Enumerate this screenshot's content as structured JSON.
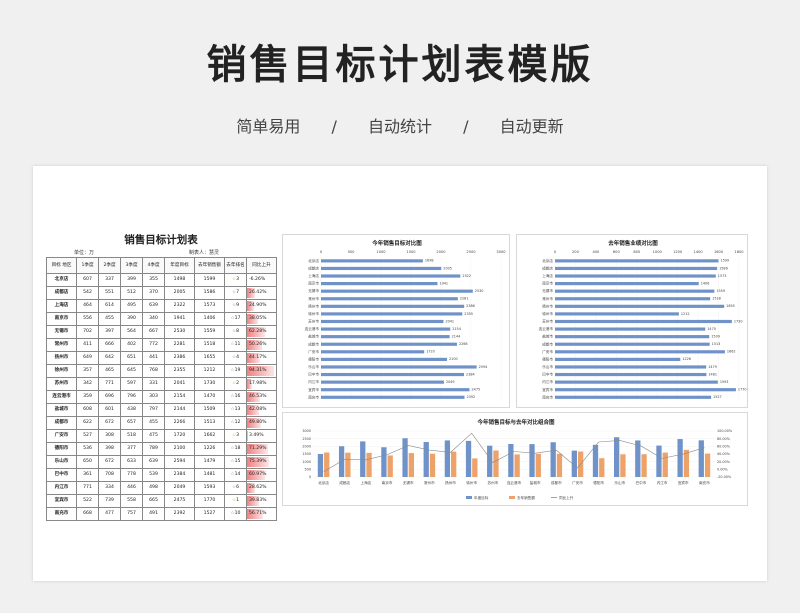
{
  "header": {
    "title": "销售目标计划表模版",
    "features": [
      "简单易用",
      "自动统计",
      "自动更新"
    ],
    "separator": "/"
  },
  "table": {
    "title": "销售目标计划表",
    "unit": "单位：万",
    "maker": "制表人：慧灵",
    "columns": [
      "目标 地区",
      "1季度",
      "2季度",
      "3季度",
      "4季度",
      "年度目标",
      "去年销售额",
      "去年排名",
      "同比上升"
    ],
    "rows": [
      [
        "北京店",
        "607",
        "337",
        "399",
        "355",
        "1498",
        "1599",
        "3",
        "-6.26%"
      ],
      [
        "成都店",
        "542",
        "551",
        "512",
        "370",
        "2005",
        "1586",
        "7",
        "26.42%"
      ],
      [
        "上海店",
        "464",
        "614",
        "495",
        "639",
        "2322",
        "1573",
        "9",
        "24.90%"
      ],
      [
        "南京市",
        "556",
        "455",
        "390",
        "340",
        "1941",
        "1406",
        "17",
        "38.05%"
      ],
      [
        "无锡市",
        "702",
        "397",
        "564",
        "667",
        "2530",
        "1559",
        "8",
        "62.28%"
      ],
      [
        "常州市",
        "411",
        "666",
        "402",
        "772",
        "2281",
        "1518",
        "11",
        "50.26%"
      ],
      [
        "扬州市",
        "649",
        "642",
        "651",
        "441",
        "2386",
        "1655",
        "4",
        "44.17%"
      ],
      [
        "徐州市",
        "357",
        "465",
        "645",
        "768",
        "2355",
        "1212",
        "19",
        "94.31%"
      ],
      [
        "苏州市",
        "342",
        "771",
        "597",
        "331",
        "2041",
        "1730",
        "2",
        "17.98%"
      ],
      [
        "连云港市",
        "359",
        "696",
        "796",
        "303",
        "2154",
        "1470",
        "16",
        "46.53%"
      ],
      [
        "盐城市",
        "608",
        "601",
        "438",
        "797",
        "2144",
        "1509",
        "13",
        "42.08%"
      ],
      [
        "成都市",
        "622",
        "672",
        "657",
        "455",
        "2266",
        "1513",
        "12",
        "49.80%"
      ],
      [
        "广安市",
        "527",
        "308",
        "518",
        "475",
        "1720",
        "1662",
        "3",
        "3.49%"
      ],
      [
        "德阳市",
        "536",
        "398",
        "377",
        "789",
        "2100",
        "1226",
        "18",
        "71.29%"
      ],
      [
        "乐山市",
        "650",
        "672",
        "633",
        "639",
        "2594",
        "1479",
        "15",
        "75.39%"
      ],
      [
        "巴中市",
        "361",
        "708",
        "778",
        "539",
        "2384",
        "1481",
        "14",
        "60.97%"
      ],
      [
        "内江市",
        "771",
        "334",
        "446",
        "498",
        "2049",
        "1593",
        "6",
        "28.62%"
      ],
      [
        "宜宾市",
        "522",
        "739",
        "558",
        "665",
        "2475",
        "1770",
        "1",
        "39.83%"
      ],
      [
        "南充市",
        "668",
        "477",
        "757",
        "491",
        "2392",
        "1527",
        "10",
        "56.71%"
      ]
    ]
  },
  "chart1": {
    "title": "今年销售目标对比图",
    "axis_ticks": [
      "0",
      "500",
      "1000",
      "1500",
      "2000",
      "2500",
      "3000"
    ]
  },
  "chart2": {
    "title": "去年销售业绩对比图",
    "axis_ticks": [
      "0",
      "200",
      "400",
      "600",
      "800",
      "1000",
      "1200",
      "1400",
      "1600",
      "1800"
    ]
  },
  "chart3": {
    "title": "今年销售目标与去年对比组合图",
    "y_left_ticks": [
      "0",
      "500",
      "1000",
      "1500",
      "2000",
      "2500",
      "3000"
    ],
    "y_right_ticks": [
      "-20.00%",
      "0.00%",
      "20.00%",
      "40.00%",
      "60.00%",
      "80.00%",
      "100.00%"
    ],
    "legend": [
      "年度目标",
      "去年销售额",
      "同比上升"
    ]
  },
  "colors": {
    "blue": "#6f93c8",
    "orange": "#eda26a",
    "gray": "#8a8a8a",
    "red": "#f08080"
  },
  "chart_data": [
    {
      "type": "bar",
      "title": "今年销售目标对比图",
      "categories": [
        "北京店",
        "成都店",
        "上海店",
        "南京市",
        "无锡市",
        "常州市",
        "扬州市",
        "徐州市",
        "苏州市",
        "连云港市",
        "盐城市",
        "成都市",
        "广安市",
        "德阳市",
        "乐山市",
        "巴中市",
        "内江市",
        "宜宾市",
        "南充市"
      ],
      "values": [
        1698,
        2005,
        2322,
        1941,
        2530,
        2281,
        2386,
        2355,
        2041,
        2154,
        2144,
        2266,
        1720,
        2100,
        2594,
        2384,
        2049,
        2475,
        2392
      ],
      "xlim": [
        0,
        3000
      ]
    },
    {
      "type": "bar",
      "title": "去年销售业绩对比图",
      "categories": [
        "北京店",
        "成都店",
        "上海店",
        "南京市",
        "无锡市",
        "常州市",
        "扬州市",
        "徐州市",
        "苏州市",
        "连云港市",
        "盐城市",
        "成都市",
        "广安市",
        "德阳市",
        "乐山市",
        "巴中市",
        "内江市",
        "宜宾市",
        "南充市"
      ],
      "values": [
        1599,
        1586,
        1573,
        1406,
        1559,
        1518,
        1655,
        1212,
        1730,
        1470,
        1509,
        1513,
        1662,
        1226,
        1479,
        1481,
        1593,
        1770,
        1527
      ],
      "xlim": [
        0,
        1800
      ]
    },
    {
      "type": "bar",
      "title": "今年销售目标与去年对比组合图",
      "categories": [
        "北京店",
        "成都店",
        "上海店",
        "南京市",
        "无锡市",
        "常州市",
        "扬州市",
        "徐州市",
        "苏州市",
        "连云港市",
        "盐城市",
        "成都市",
        "广安市",
        "德阳市",
        "乐山市",
        "巴中市",
        "内江市",
        "宜宾市",
        "南充市"
      ],
      "series": [
        {
          "name": "年度目标",
          "values": [
            1498,
            2005,
            2322,
            1941,
            2530,
            2281,
            2386,
            2355,
            2041,
            2154,
            2144,
            2266,
            1720,
            2100,
            2594,
            2384,
            2049,
            2475,
            2392
          ]
        },
        {
          "name": "去年销售额",
          "values": [
            1599,
            1586,
            1573,
            1406,
            1559,
            1518,
            1655,
            1212,
            1730,
            1470,
            1509,
            1513,
            1662,
            1226,
            1479,
            1481,
            1593,
            1770,
            1527
          ]
        },
        {
          "name": "同比上升",
          "values": [
            -6.26,
            26.42,
            24.9,
            38.05,
            62.28,
            50.26,
            44.17,
            94.31,
            17.98,
            46.53,
            42.08,
            49.8,
            3.49,
            71.29,
            75.39,
            60.97,
            28.62,
            39.83,
            56.71
          ]
        }
      ],
      "ylim": [
        0,
        3000
      ],
      "y2lim": [
        -20,
        100
      ]
    }
  ]
}
